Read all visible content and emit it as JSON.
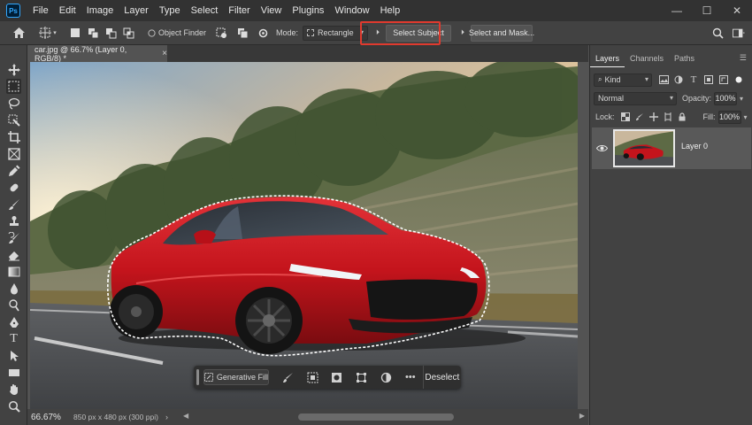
{
  "app": {
    "logo": "Ps"
  },
  "menu": [
    "File",
    "Edit",
    "Image",
    "Layer",
    "Type",
    "Select",
    "Filter",
    "View",
    "Plugins",
    "Window",
    "Help"
  ],
  "window_controls": {
    "minimize": "—",
    "maximize": "☐",
    "close": "✕"
  },
  "options_bar": {
    "object_finder_label": "Object Finder",
    "mode_label": "Mode:",
    "mode_value": "Rectangle",
    "select_subject_label": "Select Subject",
    "select_and_mask_label": "Select and Mask...",
    "highlight_color": "#e03a2e"
  },
  "document": {
    "tab_title": "car.jpg @ 66.7% (Layer 0, RGB/8) *",
    "close": "×"
  },
  "taskbar": {
    "generative_fill_label": "Generative Fill",
    "more_label": "•••",
    "deselect_label": "Deselect"
  },
  "status": {
    "zoom": "66.67%",
    "doc_info": "850 px x 480 px (300 ppi)",
    "chevron": "›"
  },
  "panel": {
    "tabs": [
      "Layers",
      "Channels",
      "Paths"
    ],
    "active_tab": "Layers",
    "kind_label": "Kind",
    "blend_mode": "Normal",
    "opacity_label": "Opacity:",
    "opacity_value": "100%",
    "lock_label": "Lock:",
    "fill_label": "Fill:",
    "fill_value": "100%",
    "layer_name": "Layer 0"
  },
  "colors": {
    "ui_dark": "#323232",
    "ui_panel": "#424242",
    "canvas_bg": "#535353",
    "car_red": "#c4141c",
    "accent_blue": "#31a8ff"
  }
}
